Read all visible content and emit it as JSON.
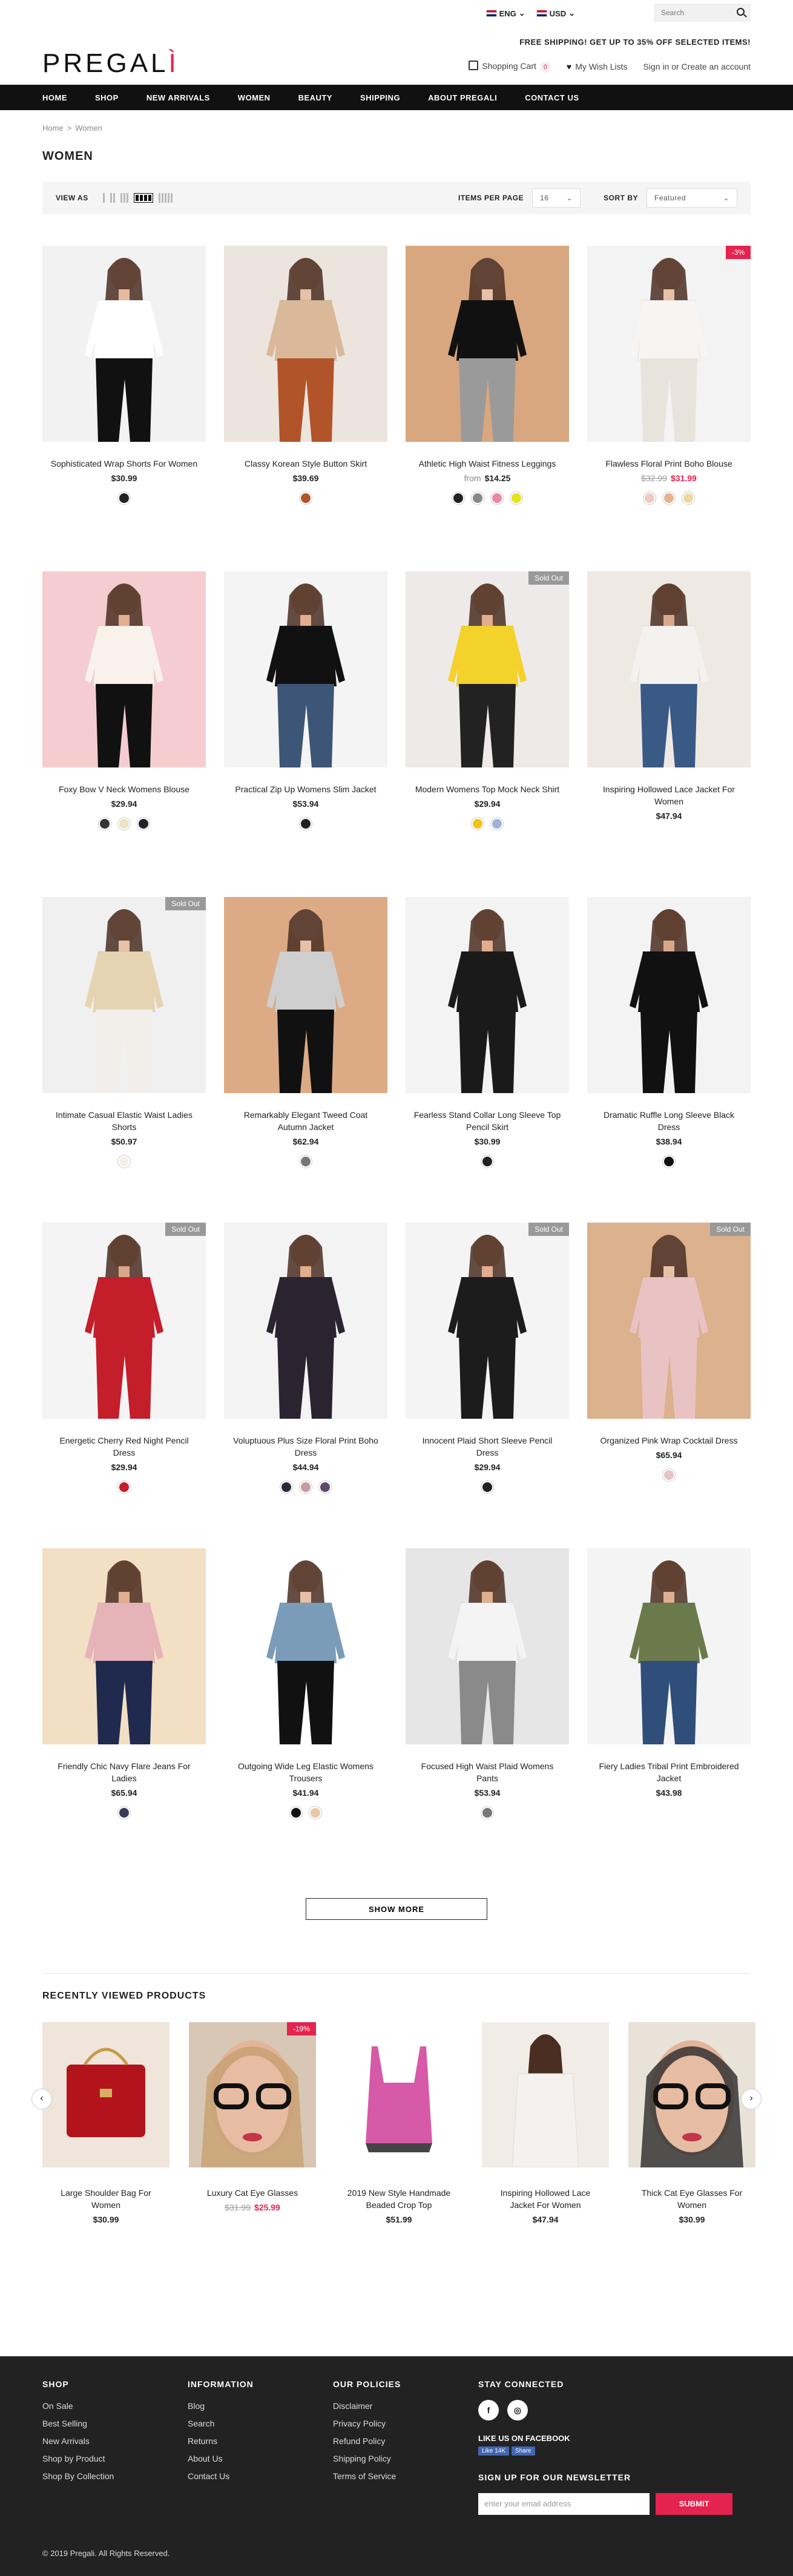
{
  "header": {
    "language": "ENG",
    "currency": "USD",
    "search_placeholder": "Search",
    "promo": "FREE SHIPPING! GET UP TO 35% OFF SELECTED ITEMS!",
    "logo": "PREGALI",
    "cart_label": "Shopping Cart",
    "cart_count": "0",
    "wishlist_label": "My Wish Lists",
    "signin": "Sign in",
    "or": "or",
    "create_account": "Create an account"
  },
  "nav": [
    "HOME",
    "SHOP",
    "NEW ARRIVALS",
    "WOMEN",
    "BEAUTY",
    "SHIPPING",
    "ABOUT PREGALI",
    "CONTACT US"
  ],
  "breadcrumb": {
    "home": "Home",
    "sep": ">",
    "current": "Women"
  },
  "page_title": "WOMEN",
  "toolbar": {
    "view_as": "VIEW AS",
    "items_per_page_label": "ITEMS PER PAGE",
    "items_per_page": "16",
    "sort_by_label": "SORT BY",
    "sort_by": "Featured"
  },
  "products": [
    {
      "name": "Sophisticated Wrap Shorts For Women",
      "price": "$30.99",
      "swatches": [
        "#222222"
      ],
      "bg": "#f2f2f2",
      "top": "#ffffff",
      "bottom": "#111111",
      "skin": "#e8b9a0"
    },
    {
      "name": "Classy Korean Style Button Skirt",
      "price": "$39.69",
      "swatches": [
        "#b2542a"
      ],
      "bg": "#ece5de",
      "top": "#d9b99a",
      "bottom": "#b2542a",
      "skin": "#e6c1a8"
    },
    {
      "name": "Athletic High Waist Fitness Leggings",
      "from": "from",
      "price": "$14.25",
      "swatches": [
        "#222222",
        "#888888",
        "#e98aa3",
        "#e5e31c"
      ],
      "bg": "#d9a77f",
      "top": "#111111",
      "bottom": "#9a9a9a",
      "skin": "#e6c1a8"
    },
    {
      "name": "Flawless Floral Print Boho Blouse",
      "old_price": "$32.99",
      "sale_price": "$31.99",
      "tag": "-3%",
      "tag_color": "red",
      "swatches": [
        "#f2c9c1",
        "#e9b28f",
        "#ecd9a2"
      ],
      "bg": "#f3f3f3",
      "top": "#f7f4f2",
      "bottom": "#e9e3de",
      "skin": "#e6c1a8"
    },
    {
      "name": "Foxy Bow V Neck Womens Blouse",
      "price": "$29.94",
      "swatches": [
        "#333333",
        "#f0e1c4",
        "#222222"
      ],
      "bg": "#f5cdd0",
      "top": "#f8f2ea",
      "bottom": "#111111",
      "skin": "#e1ae8f"
    },
    {
      "name": "Practical Zip Up Womens Slim Jacket",
      "price": "$53.94",
      "swatches": [
        "#222222"
      ],
      "bg": "#f4f4f4",
      "top": "#111111",
      "bottom": "#3d5576",
      "skin": "#e1ae8f"
    },
    {
      "name": "Modern Womens Top Mock Neck Shirt",
      "price": "$29.94",
      "tag": "Sold Out",
      "tag_color": "grey",
      "swatches": [
        "#f0c419",
        "#9fb3d9"
      ],
      "bg": "#efeaea",
      "top": "#f4d22c",
      "bottom": "#222222",
      "skin": "#e1ae8f"
    },
    {
      "name": "Inspiring Hollowed Lace Jacket For Women",
      "price": "$47.94",
      "swatches": [],
      "bg": "#efe9e4",
      "top": "#f4f1ee",
      "bottom": "#3a5a86",
      "skin": "#d9a889"
    },
    {
      "name": "Intimate Casual Elastic Waist Ladies Shorts",
      "price": "$50.97",
      "tag": "Sold Out",
      "tag_color": "grey",
      "swatches": [
        "#f5efe8"
      ],
      "bg": "#f0f0f0",
      "top": "#e6d3b2",
      "bottom": "#f2efea",
      "skin": "#e6c1a8"
    },
    {
      "name": "Remarkably Elegant Tweed Coat Autumn Jacket",
      "price": "$62.94",
      "swatches": [
        "#777777"
      ],
      "bg": "#dcab85",
      "top": "#cfcfcf",
      "bottom": "#111111",
      "skin": "#e6c1a8"
    },
    {
      "name": "Fearless Stand Collar Long Sleeve Top Pencil Skirt",
      "price": "$30.99",
      "swatches": [
        "#222222"
      ],
      "bg": "#f3f3f3",
      "top": "#1a1a1a",
      "bottom": "#1a1a1a",
      "skin": "#e1ae8f"
    },
    {
      "name": "Dramatic Ruffle Long Sleeve Black Dress",
      "price": "$38.94",
      "swatches": [
        "#111111"
      ],
      "bg": "#f3f3f3",
      "top": "#111111",
      "bottom": "#111111",
      "skin": "#d9a889"
    },
    {
      "name": "Energetic Cherry Red Night Pencil Dress",
      "price": "$29.94",
      "tag": "Sold Out",
      "tag_color": "grey",
      "swatches": [
        "#c41e2a"
      ],
      "bg": "#f4f4f4",
      "top": "#c41e2a",
      "bottom": "#c41e2a",
      "skin": "#d9a889"
    },
    {
      "name": "Voluptuous Plus Size Floral Print Boho Dress",
      "price": "$44.94",
      "swatches": [
        "#2a2a3a",
        "#c59aa0",
        "#5e4a6a"
      ],
      "bg": "#f3f3f3",
      "top": "#2b2330",
      "bottom": "#2b2330",
      "skin": "#e1ae8f"
    },
    {
      "name": "Innocent Plaid Short Sleeve Pencil Dress",
      "price": "$29.94",
      "tag": "Sold Out",
      "tag_color": "grey",
      "swatches": [
        "#222222"
      ],
      "bg": "#f4f4f4",
      "top": "#1c1c1c",
      "bottom": "#1c1c1c",
      "skin": "#e1ae8f"
    },
    {
      "name": "Organized Pink Wrap Cocktail Dress",
      "price": "$65.94",
      "tag": "Sold Out",
      "tag_color": "grey",
      "swatches": [
        "#e8c4c8"
      ],
      "bg": "#dbb18e",
      "top": "#e9c3c3",
      "bottom": "#e9c3c3",
      "skin": "#e6c1a8"
    },
    {
      "name": "Friendly Chic Navy Flare Jeans For Ladies",
      "price": "$65.94",
      "swatches": [
        "#3a3a5a"
      ],
      "bg": "#f2dfc4",
      "top": "#e5b3b8",
      "bottom": "#1f2a4e",
      "skin": "#e1ae8f"
    },
    {
      "name": "Outgoing Wide Leg Elastic Womens Trousers",
      "price": "$41.94",
      "swatches": [
        "#111111",
        "#e8c7a6"
      ],
      "bg": "#ffffff",
      "top": "#7a9cb8",
      "bottom": "#111111",
      "skin": "#e6c1a8"
    },
    {
      "name": "Focused High Waist Plaid Womens Pants",
      "price": "$53.94",
      "swatches": [
        "#777777"
      ],
      "bg": "#e6e6e6",
      "top": "#f4f4f4",
      "bottom": "#8a8a8a",
      "skin": "#e1ae8f"
    },
    {
      "name": "Fiery Ladies Tribal Print Embroidered Jacket",
      "price": "$43.98",
      "swatches": [],
      "bg": "#f4f4f4",
      "top": "#6b7a4a",
      "bottom": "#2f4f7a",
      "skin": "#e1ae8f"
    }
  ],
  "show_more": "SHOW MORE",
  "recent": {
    "title": "RECENTLY VIEWED PRODUCTS",
    "items": [
      {
        "name": "Large Shoulder Bag For Women",
        "price": "$30.99",
        "kind": "bag",
        "bg": "#efe5da"
      },
      {
        "name": "Luxury Cat Eye Glasses",
        "old_price": "$31.99",
        "sale_price": "$25.99",
        "tag": "-19%",
        "kind": "face",
        "bg": "#d8c7b4"
      },
      {
        "name": "2019 New Style Handmade Beaded Crop Top",
        "price": "$51.99",
        "kind": "top",
        "bg": "#ffffff"
      },
      {
        "name": "Inspiring Hollowed Lace Jacket For Women",
        "price": "$47.94",
        "kind": "model",
        "bg": "#f2ece6"
      },
      {
        "name": "Thick Cat Eye Glasses For Women",
        "price": "$30.99",
        "kind": "face2",
        "bg": "#e9e2d8"
      }
    ]
  },
  "footer": {
    "cols": [
      {
        "title": "SHOP",
        "links": [
          "On Sale",
          "Best Selling",
          "New Arrivals",
          "Shop by Product",
          "Shop By Collection"
        ]
      },
      {
        "title": "INFORMATION",
        "links": [
          "Blog",
          "Search",
          "Returns",
          "About Us",
          "Contact Us"
        ]
      },
      {
        "title": "OUR POLICIES",
        "links": [
          "Disclaimer",
          "Privacy Policy",
          "Refund Policy",
          "Shipping Policy",
          "Terms of Service"
        ]
      }
    ],
    "connect_title": "STAY CONNECTED",
    "facebook_like": "LIKE US ON FACEBOOK",
    "fb_like_btn": "Like 14K",
    "fb_share_btn": "Share",
    "newsletter_title": "SIGN UP FOR OUR NEWSLETTER",
    "email_placeholder": "enter your email address",
    "submit": "SUBMIT",
    "copyright": "© 2019 Pregali. All Rights Reserved."
  }
}
